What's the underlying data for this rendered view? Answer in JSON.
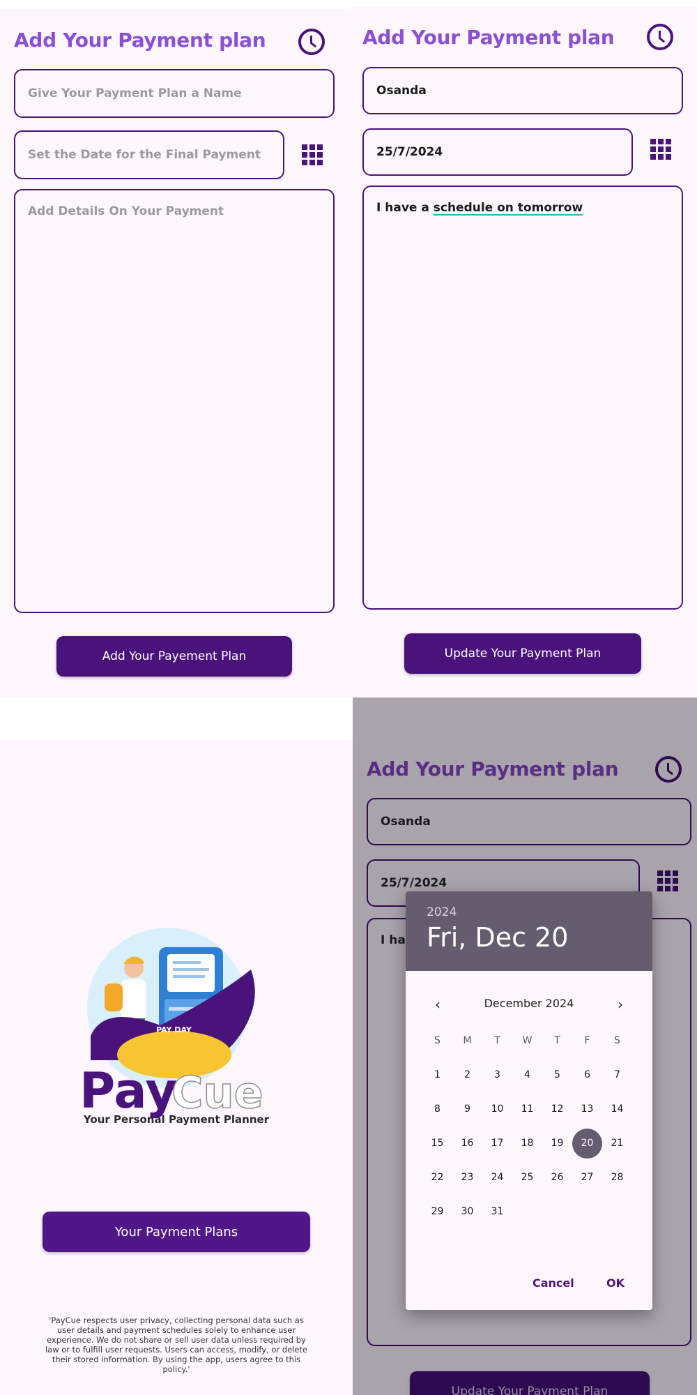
{
  "add_screen": {
    "title": "Add Your Payment plan",
    "icons": {
      "history": "clock-icon",
      "calendar": "grid-calendar-icon"
    },
    "name_placeholder": "Give Your Payment Plan a Name",
    "date_placeholder": "Set the Date for the Final Payment",
    "details_placeholder": "Add Details On Your Payment",
    "submit_label": "Add Your Payement Plan"
  },
  "update_screen": {
    "title": "Add Your Payment plan",
    "name_value": "Osanda",
    "date_value": "25/7/2024",
    "details_prefix": "I have a ",
    "details_underlined": "schedule on tomorrow",
    "submit_label": "Update Your Payment Plan"
  },
  "splash_screen": {
    "logo_text_1": "Pay",
    "logo_text_2": "Cue",
    "logo_badge": "PAY DAY",
    "tagline": "Your Personal Payment Planner",
    "plans_button": "Your Payment Plans",
    "privacy": "'PayCue respects user privacy, collecting personal data such as user details and payment schedules solely to enhance user experience. We do not share or sell user data unless required by law or to fulfill user requests. Users can access, modify, or delete their stored information. By using the app, users agree to this policy.'"
  },
  "picker_screen": {
    "title": "Add Your Payment plan",
    "name_value": "Osanda",
    "date_value": "25/7/2024",
    "details_partial": "I hav",
    "submit_label": "Update Your Payment Plan",
    "dialog": {
      "year": "2024",
      "selected_date": "Fri, Dec 20",
      "month_label": "December 2024",
      "prev_icon": "chevron-left-icon",
      "next_icon": "chevron-right-icon",
      "weekdays": [
        "S",
        "M",
        "T",
        "W",
        "T",
        "F",
        "S"
      ],
      "days": [
        [
          "1",
          "2",
          "3",
          "4",
          "5",
          "6",
          "7"
        ],
        [
          "8",
          "9",
          "10",
          "11",
          "12",
          "13",
          "14"
        ],
        [
          "15",
          "16",
          "17",
          "18",
          "19",
          "20",
          "21"
        ],
        [
          "22",
          "23",
          "24",
          "25",
          "26",
          "27",
          "28"
        ],
        [
          "29",
          "30",
          "31"
        ]
      ],
      "selected_day": "20",
      "cancel": "Cancel",
      "ok": "OK"
    }
  },
  "colors": {
    "title_purple": "#8a4fd3",
    "primary": "#4a137c",
    "background": "#fdf6fd",
    "scrim": "#a9a3ab",
    "dialog_header": "#655c70",
    "logo_yellow": "#f7c531"
  }
}
